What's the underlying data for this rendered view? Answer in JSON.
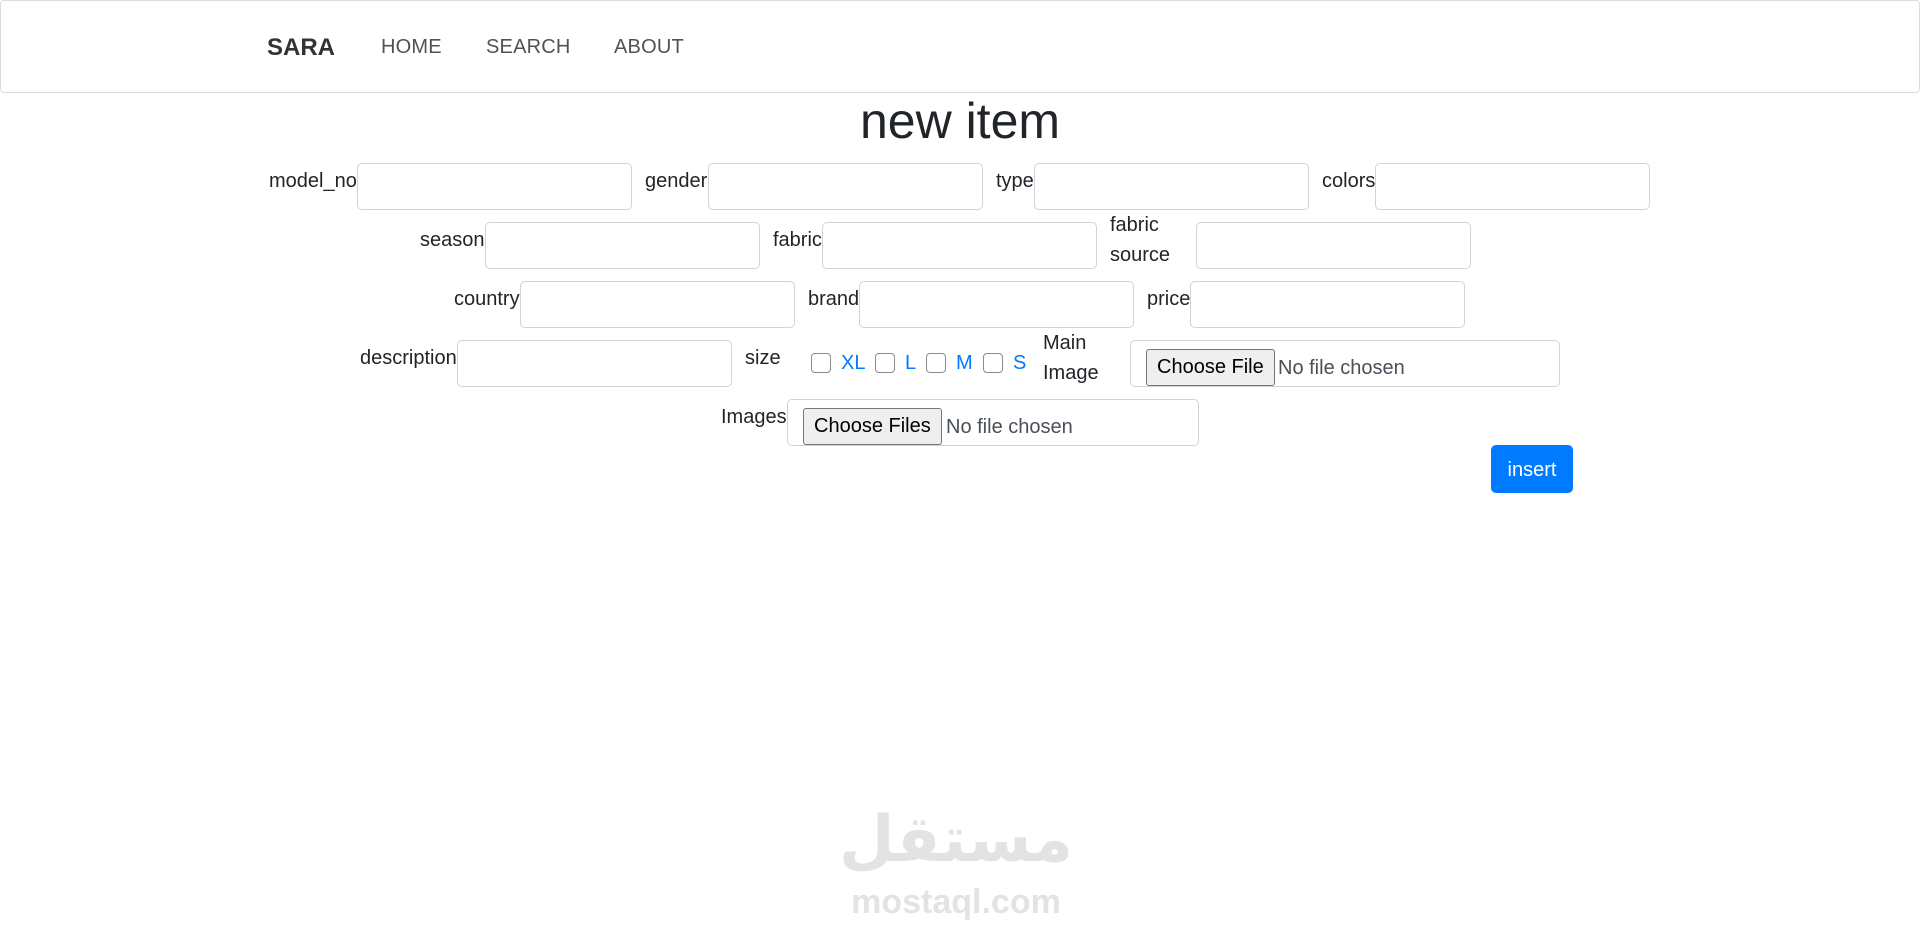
{
  "navbar": {
    "brand": "SARA",
    "links": [
      "HOME",
      "SEARCH",
      "ABOUT"
    ]
  },
  "title": "new item",
  "form": {
    "model_no_label": "model_no",
    "gender_label": "gender",
    "type_label": "type",
    "colors_label": "colors",
    "season_label": "season",
    "fabric_label": "fabric",
    "fabric_source_label": "fabric source",
    "country_label": "country",
    "brand_label": "brand",
    "price_label": "price",
    "description_label": "description",
    "size_label": "size",
    "sizes": [
      "XL",
      "L",
      "M",
      "S"
    ],
    "main_image_label": "Main Image",
    "main_image_button": "Choose File",
    "main_image_status": "No file chosen",
    "images_label": "Images",
    "images_button": "Choose Files",
    "images_status": "No file chosen",
    "insert_label": "insert"
  },
  "watermark": {
    "arabic": "مستقل",
    "latin": "mostaql.com"
  },
  "colors": {
    "primary": "#007bff",
    "text": "#212529",
    "border": "#ced4da",
    "watermark": "#e3e3e3"
  }
}
